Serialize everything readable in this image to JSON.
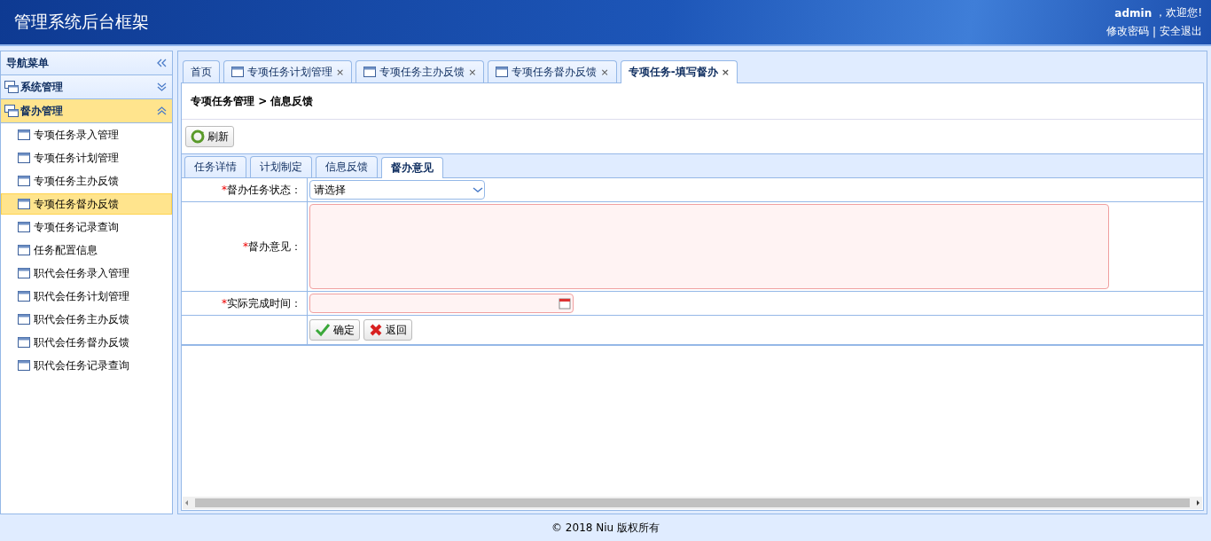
{
  "header": {
    "title": "管理系统后台框架",
    "user": "admin",
    "greeting": "，欢迎您!",
    "links": [
      {
        "label": "修改密码"
      },
      {
        "label": "安全退出"
      }
    ],
    "separator": "|"
  },
  "sidebar": {
    "title": "导航菜单",
    "groups": [
      {
        "label": "系统管理",
        "expanded": false,
        "selected": false
      },
      {
        "label": "督办管理",
        "expanded": true,
        "selected": true,
        "items": [
          {
            "label": "专项任务录入管理",
            "selected": false
          },
          {
            "label": "专项任务计划管理",
            "selected": false
          },
          {
            "label": "专项任务主办反馈",
            "selected": false
          },
          {
            "label": "专项任务督办反馈",
            "selected": true
          },
          {
            "label": "专项任务记录查询",
            "selected": false
          },
          {
            "label": "任务配置信息",
            "selected": false
          },
          {
            "label": "职代会任务录入管理",
            "selected": false
          },
          {
            "label": "职代会任务计划管理",
            "selected": false
          },
          {
            "label": "职代会任务主办反馈",
            "selected": false
          },
          {
            "label": "职代会任务督办反馈",
            "selected": false
          },
          {
            "label": "职代会任务记录查询",
            "selected": false
          }
        ]
      }
    ]
  },
  "tabs": [
    {
      "label": "首页",
      "selected": false,
      "closable": false,
      "icon": false
    },
    {
      "label": "专项任务计划管理",
      "selected": false,
      "closable": true,
      "icon": true
    },
    {
      "label": "专项任务主办反馈",
      "selected": false,
      "closable": true,
      "icon": true
    },
    {
      "label": "专项任务督办反馈",
      "selected": false,
      "closable": true,
      "icon": true
    },
    {
      "label": "专项任务-填写督办",
      "selected": true,
      "closable": true,
      "icon": false
    }
  ],
  "close_glyph": "×",
  "breadcrumb": "专项任务管理 > 信息反馈",
  "toolbar": {
    "refresh": "刷新"
  },
  "subtabs": [
    {
      "label": "任务详情",
      "selected": false
    },
    {
      "label": "计划制定",
      "selected": false
    },
    {
      "label": "信息反馈",
      "selected": false
    },
    {
      "label": "督办意见",
      "selected": true
    }
  ],
  "form": {
    "fields": [
      {
        "kind": "select",
        "required_mark": "*",
        "label": "督办任务状态：",
        "value": "请选择"
      },
      {
        "kind": "textarea",
        "required_mark": "*",
        "label": "督办意见："
      },
      {
        "kind": "date",
        "required_mark": "*",
        "label": "实际完成时间："
      }
    ],
    "buttons": [
      {
        "kind": "ok",
        "label": "确定"
      },
      {
        "kind": "back",
        "label": "返回"
      }
    ]
  },
  "footer": "© 2018 Niu 版权所有"
}
